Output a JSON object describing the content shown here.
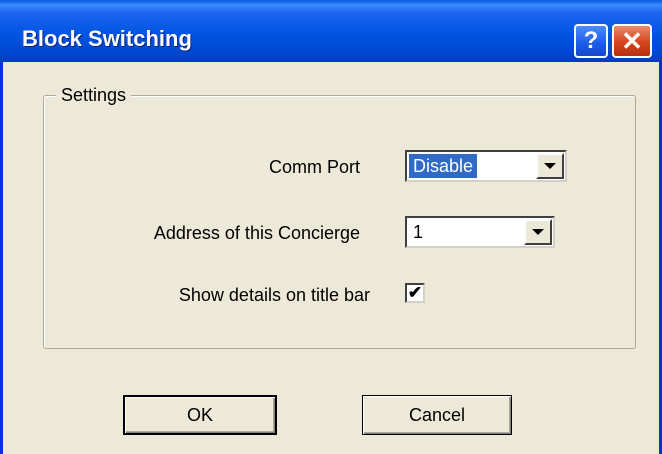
{
  "window": {
    "title": "Block Switching",
    "help_label": "?",
    "close_label": "✕"
  },
  "settings": {
    "group_label": "Settings",
    "comm_port": {
      "label": "Comm Port",
      "value": "Disable"
    },
    "address": {
      "label": "Address of this Concierge",
      "value": "1"
    },
    "show_details": {
      "label": "Show details on title bar",
      "checked": true,
      "mark": "✔"
    }
  },
  "buttons": {
    "ok_label": "OK",
    "cancel_label": "Cancel"
  },
  "colors": {
    "title_bar": "#0054E3",
    "dialog_bg": "#ECE9D8",
    "selection": "#316AC5",
    "close_button": "#D6441C"
  },
  "icons": [
    "help-icon",
    "close-icon",
    "dropdown-arrow-icon",
    "checkmark-icon"
  ]
}
